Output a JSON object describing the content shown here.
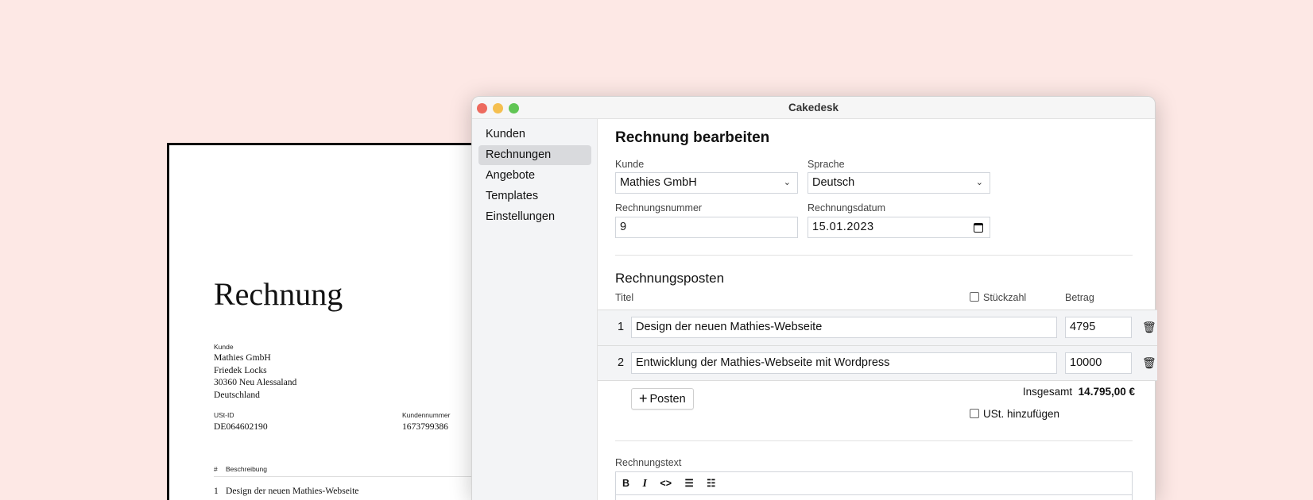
{
  "document": {
    "title": "Rechnung",
    "customer_label": "Kunde",
    "customer_lines": [
      "Mathies GmbH",
      "Friedek Locks",
      "30360 Neu Alessaland",
      "Deutschland"
    ],
    "vat_id_label": "USt-ID",
    "vat_id": "DE064602190",
    "customer_number_label": "Kundennummer",
    "customer_number": "1673799386",
    "table_hash": "#",
    "table_desc": "Beschreibung",
    "first_item_no": "1",
    "first_item": "Design der neuen Mathies-Webseite"
  },
  "window": {
    "title": "Cakedesk",
    "colors": {
      "close": "#ed6a5e",
      "minimize": "#f5bf4f",
      "maximize": "#61c554"
    }
  },
  "sidebar": {
    "items": [
      {
        "label": "Kunden"
      },
      {
        "label": "Rechnungen",
        "selected": true
      },
      {
        "label": "Angebote"
      },
      {
        "label": "Templates"
      },
      {
        "label": "Einstellungen"
      }
    ]
  },
  "form": {
    "heading": "Rechnung bearbeiten",
    "customer_label": "Kunde",
    "customer_value": "Mathies GmbH",
    "language_label": "Sprache",
    "language_value": "Deutsch",
    "number_label": "Rechnungsnummer",
    "number_value": "9",
    "date_label": "Rechnungsdatum",
    "date_value": "15.01.2023",
    "items_heading": "Rechnungsposten",
    "col_title": "Titel",
    "col_quantity": "Stückzahl",
    "col_amount": "Betrag",
    "items": [
      {
        "no": "1",
        "title": "Design der neuen Mathies-Webseite",
        "amount": "4795"
      },
      {
        "no": "2",
        "title": "Entwicklung der Mathies-Webseite mit Wordpress",
        "amount": "10000"
      }
    ],
    "add_item": "Posten",
    "total_label": "Insgesamt",
    "total_value": "14.795,00 €",
    "vat_checkbox": "USt. hinzufügen",
    "text_label": "Rechnungstext",
    "toolbar": {
      "bold": "B",
      "italic": "I",
      "code": "<>",
      "bullets": "☰",
      "numbered": "☷"
    }
  }
}
